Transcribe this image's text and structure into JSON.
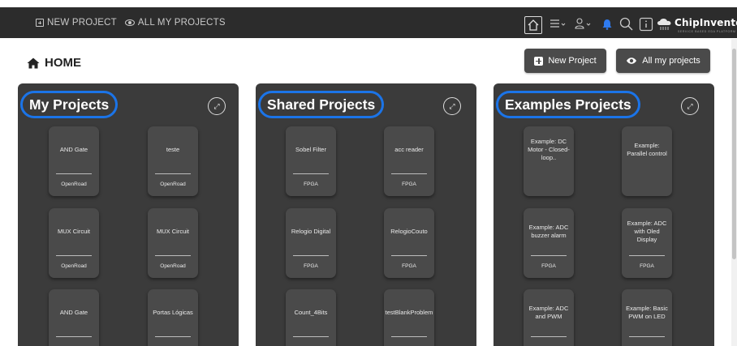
{
  "topbar": {
    "new_project": "NEW PROJECT",
    "all_projects": "ALL MY PROJECTS",
    "logo_title": "ChipInventor",
    "logo_subtitle": "SERVICE BASED EDA PLATFORM"
  },
  "page": {
    "title": "HOME"
  },
  "actions": {
    "new_project": "New Project",
    "all_projects": "All my projects"
  },
  "colors": {
    "highlight": "#1b74e8",
    "bell": "#2f7bf0",
    "panel": "#3b3b3b",
    "card": "#4a4a4a",
    "topbar": "#2c2c2c"
  },
  "panels": [
    {
      "title": "My Projects",
      "cards": [
        {
          "name": "AND Gate",
          "type": "OpenRoad"
        },
        {
          "name": "teste",
          "type": "OpenRoad"
        },
        {
          "name": "MUX Circuit",
          "type": "OpenRoad"
        },
        {
          "name": "MUX Circuit",
          "type": "OpenRoad"
        },
        {
          "name": "AND Gate",
          "type": ""
        },
        {
          "name": "Portas Lógicas",
          "type": ""
        }
      ]
    },
    {
      "title": "Shared Projects",
      "cards": [
        {
          "name": "Sobel Filter",
          "type": "FPGA"
        },
        {
          "name": "acc reader",
          "type": "FPGA"
        },
        {
          "name": "Relogio Digital",
          "type": "FPGA"
        },
        {
          "name": "RelogioCouto",
          "type": "FPGA"
        },
        {
          "name": "Count_4Bits",
          "type": ""
        },
        {
          "name": "testBlankProblem",
          "type": ""
        }
      ]
    },
    {
      "title": "Examples Projects",
      "cards": [
        {
          "name": "Example: DC Motor - Closed-loop..",
          "type": ""
        },
        {
          "name": "Example: Parallel control",
          "type": ""
        },
        {
          "name": "Example: ADC buzzer alarm",
          "type": "FPGA"
        },
        {
          "name": "Example: ADC with Oled Display",
          "type": "FPGA"
        },
        {
          "name": "Example: ADC and PWM",
          "type": ""
        },
        {
          "name": "Example: Basic PWM on LED",
          "type": ""
        }
      ]
    }
  ]
}
